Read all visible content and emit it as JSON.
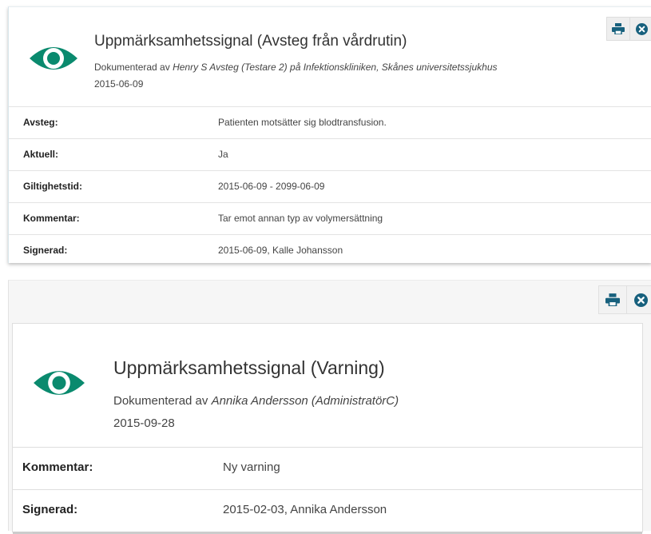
{
  "colors": {
    "eye": "#0a8a6e",
    "icon": "#17607d"
  },
  "card1": {
    "title": "Uppmärksamhetssignal (Avsteg från vårdrutin)",
    "documented_prefix": "Dokumenterad av ",
    "documented_by": "Henry S Avsteg (Testare 2) på Infektionskliniken, Skånes universitetssjukhus",
    "date": "2015-06-09",
    "icons": {
      "print": "print-icon",
      "close": "close-circle-icon"
    },
    "rows": [
      {
        "label": "Avsteg:",
        "value": "Patienten motsätter sig blodtransfusion."
      },
      {
        "label": "Aktuell:",
        "value": "Ja"
      },
      {
        "label": "Giltighetstid:",
        "value": "2015-06-09 - 2099-06-09"
      },
      {
        "label": "Kommentar:",
        "value": "Tar emot annan typ av volymersättning"
      },
      {
        "label": "Signerad:",
        "value": "2015-06-09, Kalle Johansson"
      }
    ]
  },
  "card2": {
    "title": "Uppmärksamhetssignal (Varning)",
    "documented_prefix": "Dokumenterad av ",
    "documented_by": "Annika Andersson (AdministratörC)",
    "date": "2015-09-28",
    "icons": {
      "print": "print-icon",
      "close": "close-circle-icon"
    },
    "rows": [
      {
        "label": "Kommentar:",
        "value": "Ny varning"
      },
      {
        "label": "Signerad:",
        "value": "2015-02-03, Annika Andersson"
      }
    ]
  }
}
